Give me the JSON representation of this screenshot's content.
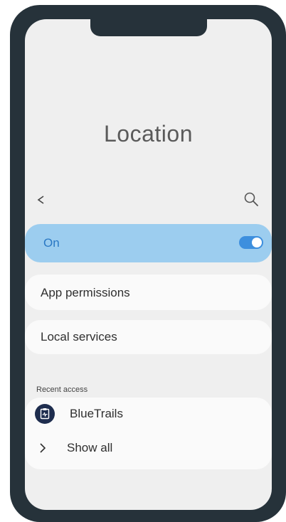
{
  "header": {
    "title": "Location"
  },
  "toggle": {
    "label": "On",
    "state": "on",
    "accent_color": "#3d8fde",
    "row_color": "#9ccdef"
  },
  "menu": [
    {
      "label": "App permissions"
    },
    {
      "label": "Local services"
    }
  ],
  "recent": {
    "section_title": "Recent access",
    "apps": [
      {
        "name": "BlueTrails",
        "icon": "clipboard-pulse-icon"
      }
    ],
    "show_all_label": "Show all"
  },
  "icons": {
    "back": "chevron-left-icon",
    "search": "search-icon",
    "show_all": "chevron-right-icon"
  },
  "colors": {
    "frame": "#26323a",
    "screen": "#efefef",
    "card": "#fafafa"
  }
}
